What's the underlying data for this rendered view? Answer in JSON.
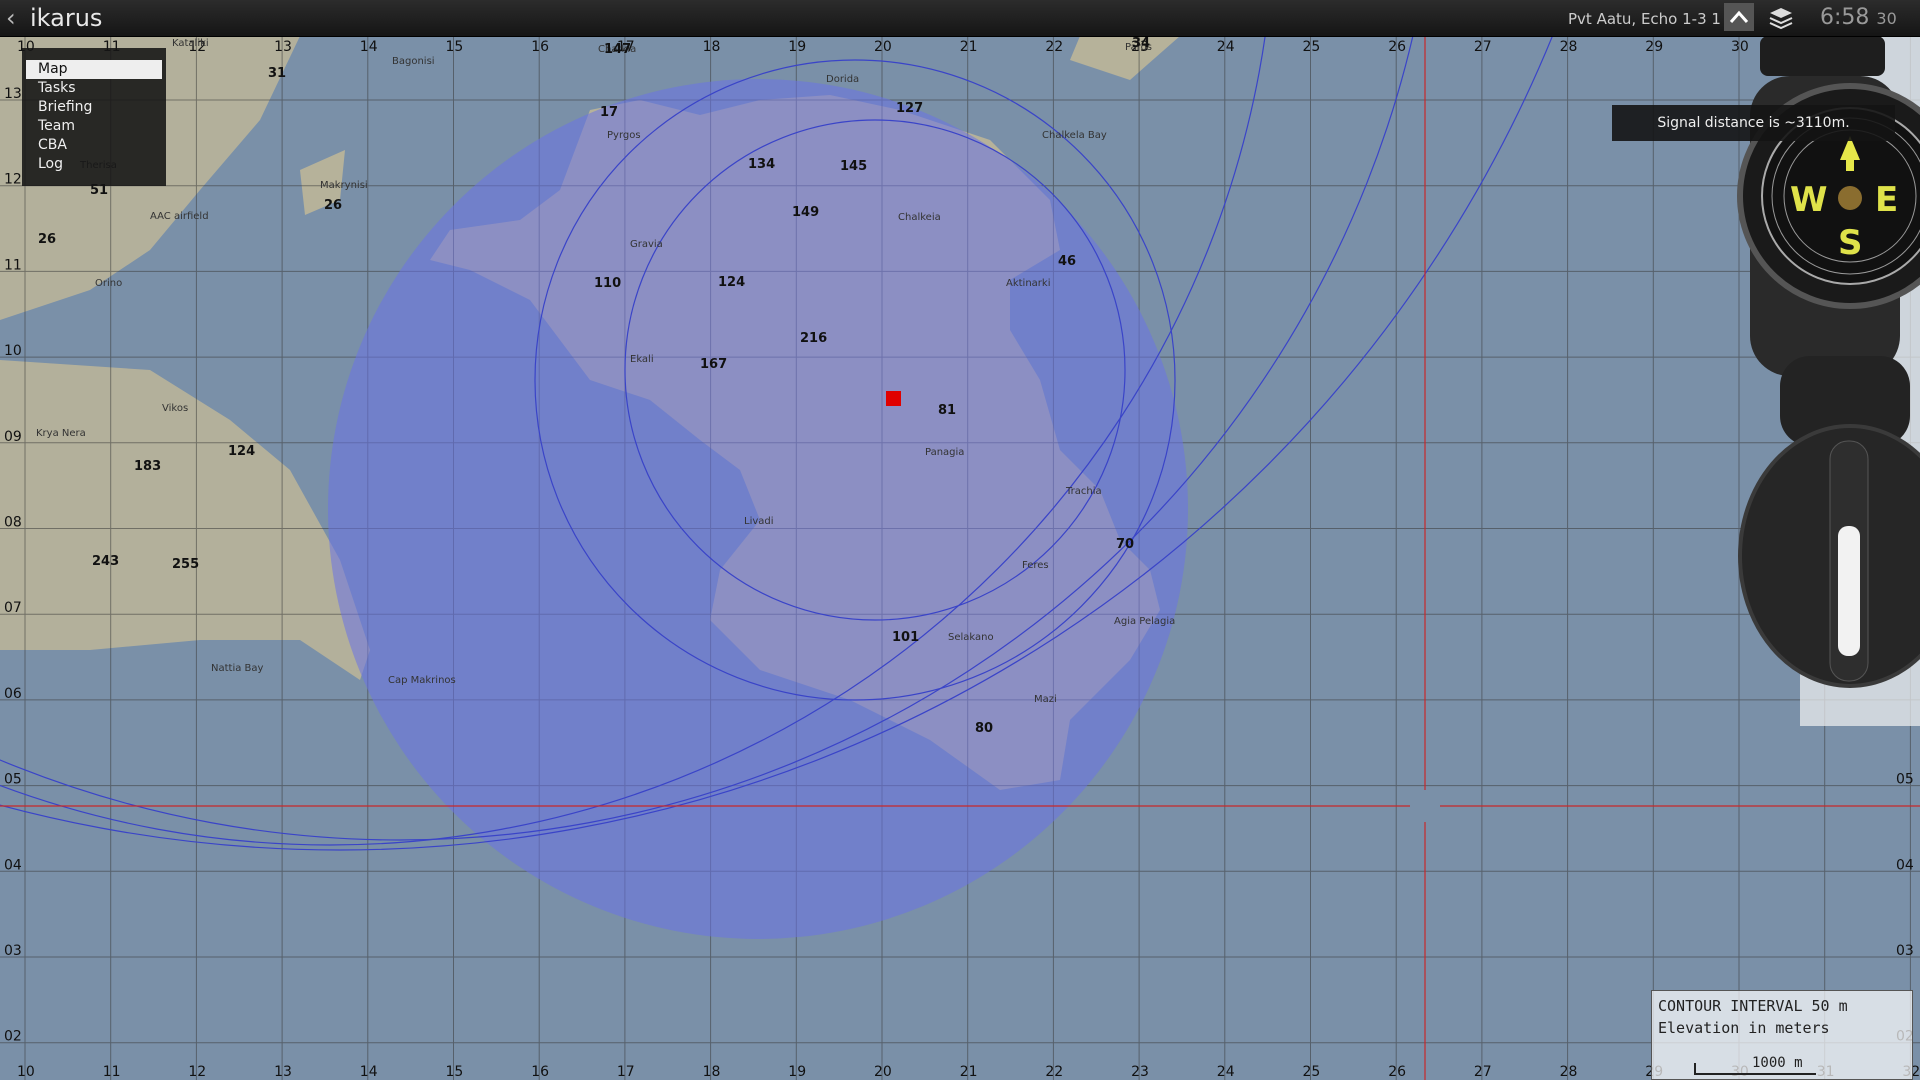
{
  "topbar": {
    "back_icon": "chevron-left",
    "title": "ikarus",
    "player": "Pvt Aatu, Echo 1-3 1",
    "clock_main": "6:58",
    "clock_sec": "30"
  },
  "menu": {
    "items": [
      "Map",
      "Tasks",
      "Briefing",
      "Team",
      "CBA",
      "Log"
    ],
    "active": "Map"
  },
  "signal": {
    "text": "Signal distance is ~3110m."
  },
  "legend": {
    "contour": "CONTOUR INTERVAL 50 m",
    "elevation": "Elevation in meters",
    "scale": "1000 m"
  },
  "grid": {
    "top_labels": [
      "10",
      "11",
      "12",
      "13",
      "14",
      "15",
      "16",
      "17",
      "18",
      "19",
      "20",
      "21",
      "22",
      "23",
      "24",
      "25",
      "26",
      "27",
      "28",
      "29",
      "30"
    ],
    "bottom_labels": [
      "10",
      "11",
      "12",
      "13",
      "14",
      "15",
      "16",
      "17",
      "18",
      "19",
      "20",
      "21",
      "22",
      "23",
      "24",
      "25",
      "26",
      "27",
      "28",
      "29",
      "30",
      "31",
      "32"
    ],
    "left_labels": [
      "13",
      "12",
      "11",
      "10",
      "09",
      "08",
      "07",
      "06",
      "05",
      "04",
      "03",
      "02"
    ],
    "right_labels": [
      "05",
      "04",
      "03",
      "02"
    ]
  },
  "places": [
    {
      "name": "Kataliki"
    },
    {
      "name": "Bagonisi"
    },
    {
      "name": "Dorida"
    },
    {
      "name": "Pyrgos"
    },
    {
      "name": "Chalkela Bay"
    },
    {
      "name": "Chalkeia"
    },
    {
      "name": "Aktinarki"
    },
    {
      "name": "Ekali"
    },
    {
      "name": "Panagia"
    },
    {
      "name": "Livadi"
    },
    {
      "name": "Feres"
    },
    {
      "name": "Selakano"
    },
    {
      "name": "Agia Pelagia"
    },
    {
      "name": "Mazi"
    },
    {
      "name": "Nattia Bay"
    },
    {
      "name": "Cap Makrinos"
    },
    {
      "name": "Vikos"
    },
    {
      "name": "Orino"
    },
    {
      "name": "Krya Nera"
    },
    {
      "name": "Makrynisi"
    },
    {
      "name": "AAC airfield"
    },
    {
      "name": "Gravia"
    },
    {
      "name": "Trachia"
    },
    {
      "name": "Therisa"
    },
    {
      "name": "Charkia"
    },
    {
      "name": "Paros"
    }
  ],
  "heights": [
    "147",
    "31",
    "17",
    "127",
    "134",
    "145",
    "149",
    "46",
    "110",
    "124",
    "216",
    "167",
    "81",
    "70",
    "101",
    "80",
    "51",
    "26",
    "26",
    "183",
    "124",
    "243",
    "255",
    "34"
  ],
  "colors": {
    "water": "#7a90a8",
    "land": "#b8b49a",
    "signal_circle": "#6a72e6",
    "ring": "#3a44c8",
    "marker": "#e00000",
    "crosshair": "#c8282a"
  }
}
